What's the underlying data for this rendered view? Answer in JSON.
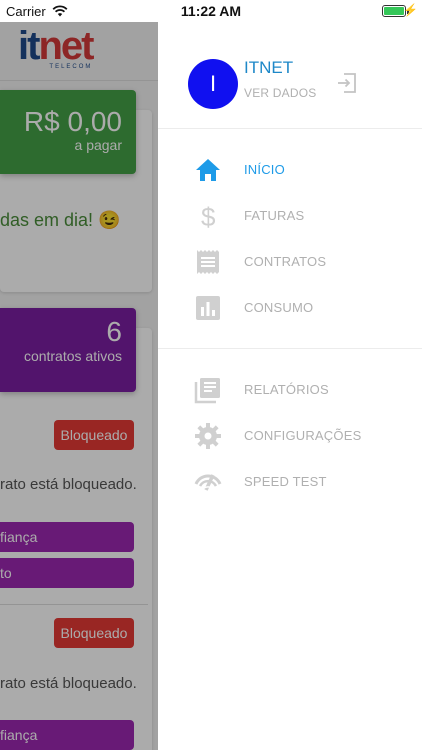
{
  "status_bar": {
    "carrier": "Carrier",
    "time": "11:22 AM"
  },
  "background": {
    "logo": {
      "main_it": "it",
      "main_net": "net",
      "sub": "TELECOM"
    },
    "balance": {
      "amount": "R$ 0,00",
      "label": "a pagar"
    },
    "status_message": "das em dia! 😉",
    "contracts": {
      "count": "6",
      "label": "contratos ativos"
    },
    "contract_items": [
      {
        "badge": "Bloqueado",
        "message": "rato está bloqueado.",
        "buttons": [
          "fiança",
          "to"
        ]
      },
      {
        "badge": "Bloqueado",
        "message": "rato está bloqueado.",
        "buttons": [
          "fiança"
        ]
      }
    ]
  },
  "drawer": {
    "avatar_initial": "I",
    "user_name": "ITNET",
    "user_link": "VER DADOS",
    "menu_primary": [
      {
        "label": "INÍCIO",
        "icon": "home-icon",
        "active": true
      },
      {
        "label": "FATURAS",
        "icon": "dollar-icon",
        "active": false
      },
      {
        "label": "CONTRATOS",
        "icon": "contract-icon",
        "active": false
      },
      {
        "label": "CONSUMO",
        "icon": "bar-chart-icon",
        "active": false
      }
    ],
    "menu_secondary": [
      {
        "label": "RELATÓRIOS",
        "icon": "reports-icon"
      },
      {
        "label": "CONFIGURAÇÕES",
        "icon": "gear-icon"
      },
      {
        "label": "SPEED TEST",
        "icon": "speedometer-icon"
      }
    ]
  },
  "colors": {
    "accent": "#1e9be8",
    "avatar": "#1010f0",
    "green": "#43a047",
    "purple": "#7b1fa2",
    "red": "#e53935",
    "muted": "#b0b0b0"
  }
}
